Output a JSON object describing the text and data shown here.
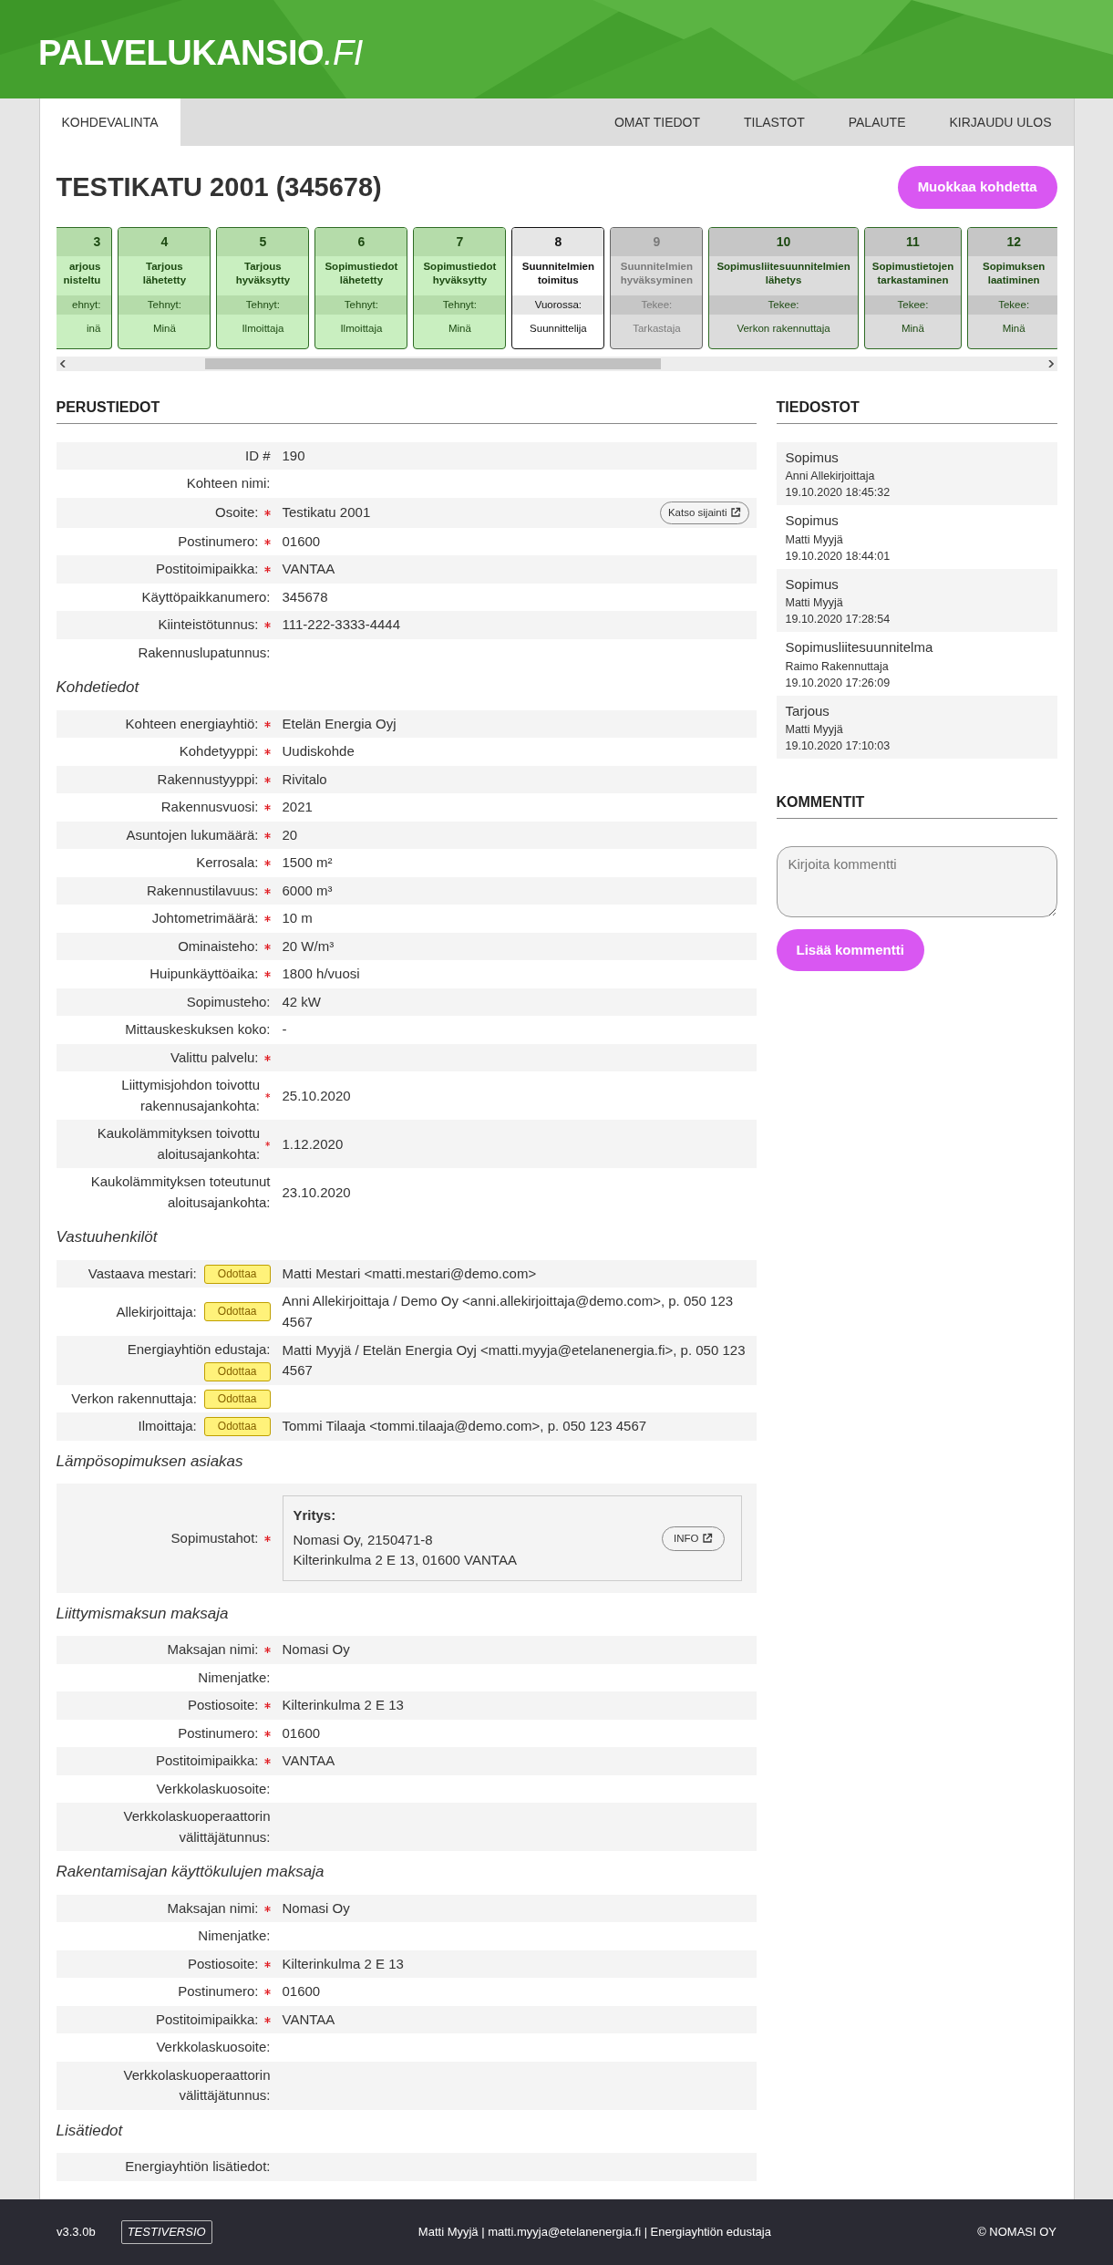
{
  "brand": {
    "name": "PALVELUKANSIO",
    "suffix": ".FI"
  },
  "nav": {
    "left": [
      {
        "label": "KOHDEVALINTA",
        "selected": true
      }
    ],
    "right": [
      {
        "label": "OMAT TIEDOT",
        "selected": false
      },
      {
        "label": "TILASTOT",
        "selected": false
      },
      {
        "label": "PALAUTE",
        "selected": false
      },
      {
        "label": "KIRJAUDU ULOS",
        "selected": false
      }
    ]
  },
  "title": "TESTIKATU 2001 (345678)",
  "edit_button": "Muokkaa kohdetta",
  "steps": [
    {
      "number": "3",
      "title": [
        "arjous",
        "nisteltu"
      ],
      "role": "ehnyt:",
      "person": "inä",
      "done": true,
      "current": false,
      "disabled": false,
      "cut": true
    },
    {
      "number": "4",
      "title": [
        "Tarjous",
        "lähetetty"
      ],
      "role": "Tehnyt:",
      "person": "Minä",
      "done": true,
      "current": false,
      "disabled": false
    },
    {
      "number": "5",
      "title": [
        "Tarjous",
        "hyväksytty"
      ],
      "role": "Tehnyt:",
      "person": "Ilmoittaja",
      "done": true,
      "current": false,
      "disabled": false
    },
    {
      "number": "6",
      "title": [
        "Sopimustiedot",
        "lähetetty"
      ],
      "role": "Tehnyt:",
      "person": "Ilmoittaja",
      "done": true,
      "current": false,
      "disabled": false
    },
    {
      "number": "7",
      "title": [
        "Sopimustiedot",
        "hyväksytty"
      ],
      "role": "Tehnyt:",
      "person": "Minä",
      "done": true,
      "current": false,
      "disabled": false
    },
    {
      "number": "8",
      "title": [
        "Suunnitelmien",
        "toimitus"
      ],
      "role": "Vuorossa:",
      "person": "Suunnittelija",
      "done": false,
      "current": true,
      "disabled": false
    },
    {
      "number": "9",
      "title": [
        "Suunnitelmien",
        "hyväksyminen"
      ],
      "role": "Tekee:",
      "person": "Tarkastaja",
      "done": false,
      "current": false,
      "disabled": true
    },
    {
      "number": "10",
      "title": [
        "Sopimusliitesuunnitelmien",
        "lähetys"
      ],
      "role": "Tekee:",
      "person": "Verkon rakennuttaja",
      "done": false,
      "current": false,
      "disabled": false
    },
    {
      "number": "11",
      "title": [
        "Sopimustietojen",
        "tarkastaminen"
      ],
      "role": "Tekee:",
      "person": "Minä",
      "done": false,
      "current": false,
      "disabled": false
    },
    {
      "number": "12",
      "title": [
        "Sopimuksen",
        "laatiminen"
      ],
      "role": "Tekee:",
      "person": "Minä",
      "done": false,
      "current": false,
      "disabled": false
    }
  ],
  "details": {
    "heading": "PERUSTIEDOT",
    "groups": [
      {
        "rows": [
          {
            "label": "ID #",
            "required": false,
            "value": "190"
          },
          {
            "label": "Kohteen nimi:",
            "required": false
          },
          {
            "label": "Osoite:",
            "required": true,
            "value": "Testikatu 2001",
            "action": "Katso sijainti"
          },
          {
            "label": "Postinumero:",
            "required": true,
            "value": "01600"
          },
          {
            "label": "Postitoimipaikka:",
            "required": true,
            "value": "VANTAA"
          },
          {
            "label": "Käyttöpaikkanumero:",
            "required": false,
            "value": "345678"
          },
          {
            "label": "Kiinteistötunnus:",
            "required": true,
            "value": "111-222-3333-4444"
          },
          {
            "label": "Rakennuslupatunnus:",
            "required": false
          }
        ]
      },
      {
        "title": "Kohdetiedot",
        "rows": [
          {
            "label": "Kohteen energiayhtiö:",
            "required": true,
            "value": "Etelän Energia Oyj"
          },
          {
            "label": "Kohdetyyppi:",
            "required": true,
            "value": "Uudiskohde"
          },
          {
            "label": "Rakennustyyppi:",
            "required": true,
            "value": "Rivitalo"
          },
          {
            "label": "Rakennusvuosi:",
            "required": true,
            "value": "2021"
          },
          {
            "label": "Asuntojen lukumäärä:",
            "required": true,
            "value": "20"
          },
          {
            "label": "Kerrosala:",
            "required": true,
            "value": "1500 m²"
          },
          {
            "label": "Rakennustilavuus:",
            "required": true,
            "value": "6000 m³"
          },
          {
            "label": "Johtometrimäärä:",
            "required": true,
            "value": "10 m"
          },
          {
            "label": "Ominaisteho:",
            "required": true,
            "value": "20 W/m³"
          },
          {
            "label": "Huipunkäyttöaika:",
            "required": true,
            "value": "1800 h/vuosi"
          },
          {
            "label": "Sopimusteho:",
            "required": false,
            "value": "42 kW"
          },
          {
            "label": "Mittauskeskuksen koko:",
            "required": false,
            "value": "-"
          },
          {
            "label": "Valittu palvelu:",
            "required": true
          },
          {
            "label": "Liittymisjohdon toivottu rakennusajankohta:",
            "required": true,
            "value": "25.10.2020"
          },
          {
            "label": "Kaukolämmityksen toivottu aloitusajankohta:",
            "required": true,
            "value": "1.12.2020"
          },
          {
            "label": "Kaukolämmityksen toteutunut aloitusajankohta:",
            "required": false,
            "value": "23.10.2020"
          }
        ]
      },
      {
        "title": "Vastuuhenkilöt",
        "rows": [
          {
            "label": "Vastaava mestari:",
            "required": false,
            "badge": "Odottaa",
            "value": "Matti Mestari <matti.mestari@demo.com>"
          },
          {
            "label": "Allekirjoittaja:",
            "required": false,
            "badge": "Odottaa",
            "value": "Anni Allekirjoittaja / Demo Oy <anni.allekirjoittaja@demo.com>, p. 050 123 4567"
          },
          {
            "label": "Energiayhtiön edustaja:",
            "required": false,
            "badge": "Odottaa",
            "value": "Matti Myyjä / Etelän Energia Oyj <matti.myyja@etelanenergia.fi>, p. 050 123 4567"
          },
          {
            "label": "Verkon rakennuttaja:",
            "required": false,
            "badge": "Odottaa"
          },
          {
            "label": "Ilmoittaja:",
            "required": false,
            "badge": "Odottaa",
            "value": "Tommi Tilaaja <tommi.tilaaja@demo.com>, p. 050 123 4567"
          }
        ]
      },
      {
        "title": "Lämpösopimuksen asiakas",
        "rows": [
          {
            "label": "Sopimustahot:",
            "required": true,
            "party": {
              "heading": "Yritys:",
              "lines": [
                "Nomasi Oy, 2150471-8",
                "Kilterinkulma 2 E 13, 01600 VANTAA"
              ],
              "button": "INFO"
            }
          }
        ]
      },
      {
        "title": "Liittymismaksun maksaja",
        "rows": [
          {
            "label": "Maksajan nimi:",
            "required": true,
            "value": "Nomasi Oy"
          },
          {
            "label": "Nimenjatke:",
            "required": false
          },
          {
            "label": "Postiosoite:",
            "required": true,
            "value": "Kilterinkulma 2 E 13"
          },
          {
            "label": "Postinumero:",
            "required": true,
            "value": "01600"
          },
          {
            "label": "Postitoimipaikka:",
            "required": true,
            "value": "VANTAA"
          },
          {
            "label": "Verkkolaskuosoite:",
            "required": false
          },
          {
            "label": "Verkkolaskuoperaattorin välittäjätunnus:",
            "required": false
          }
        ]
      },
      {
        "title": "Rakentamisajan käyttökulujen maksaja",
        "rows": [
          {
            "label": "Maksajan nimi:",
            "required": true,
            "value": "Nomasi Oy"
          },
          {
            "label": "Nimenjatke:",
            "required": false
          },
          {
            "label": "Postiosoite:",
            "required": true,
            "value": "Kilterinkulma 2 E 13"
          },
          {
            "label": "Postinumero:",
            "required": true,
            "value": "01600"
          },
          {
            "label": "Postitoimipaikka:",
            "required": true,
            "value": "VANTAA"
          },
          {
            "label": "Verkkolaskuosoite:",
            "required": false
          },
          {
            "label": "Verkkolaskuoperaattorin välittäjätunnus:",
            "required": false
          }
        ]
      },
      {
        "title": "Lisätiedot",
        "rows": [
          {
            "label": "Energiayhtiön lisätiedot:",
            "required": false
          }
        ]
      }
    ]
  },
  "files": {
    "heading": "TIEDOSTOT",
    "items": [
      {
        "name": "Sopimus",
        "author": "Anni Allekirjoittaja",
        "time": "19.10.2020 18:45:32"
      },
      {
        "name": "Sopimus",
        "author": "Matti Myyjä",
        "time": "19.10.2020 18:44:01"
      },
      {
        "name": "Sopimus",
        "author": "Matti Myyjä",
        "time": "19.10.2020 17:28:54"
      },
      {
        "name": "Sopimusliitesuunnitelma",
        "author": "Raimo Rakennuttaja",
        "time": "19.10.2020 17:26:09"
      },
      {
        "name": "Tarjous",
        "author": "Matti Myyjä",
        "time": "19.10.2020 17:10:03"
      }
    ]
  },
  "comments": {
    "heading": "KOMMENTIT",
    "placeholder": "Kirjoita kommentti",
    "button": "Lisää kommentti"
  },
  "footer": {
    "version": "v3.3.0b",
    "tag": "TESTIVERSIO",
    "user": "Matti Myyjä | matti.myyja@etelanenergia.fi | Energiayhtiön edustaja",
    "copyright": "© NOMASI OY"
  }
}
